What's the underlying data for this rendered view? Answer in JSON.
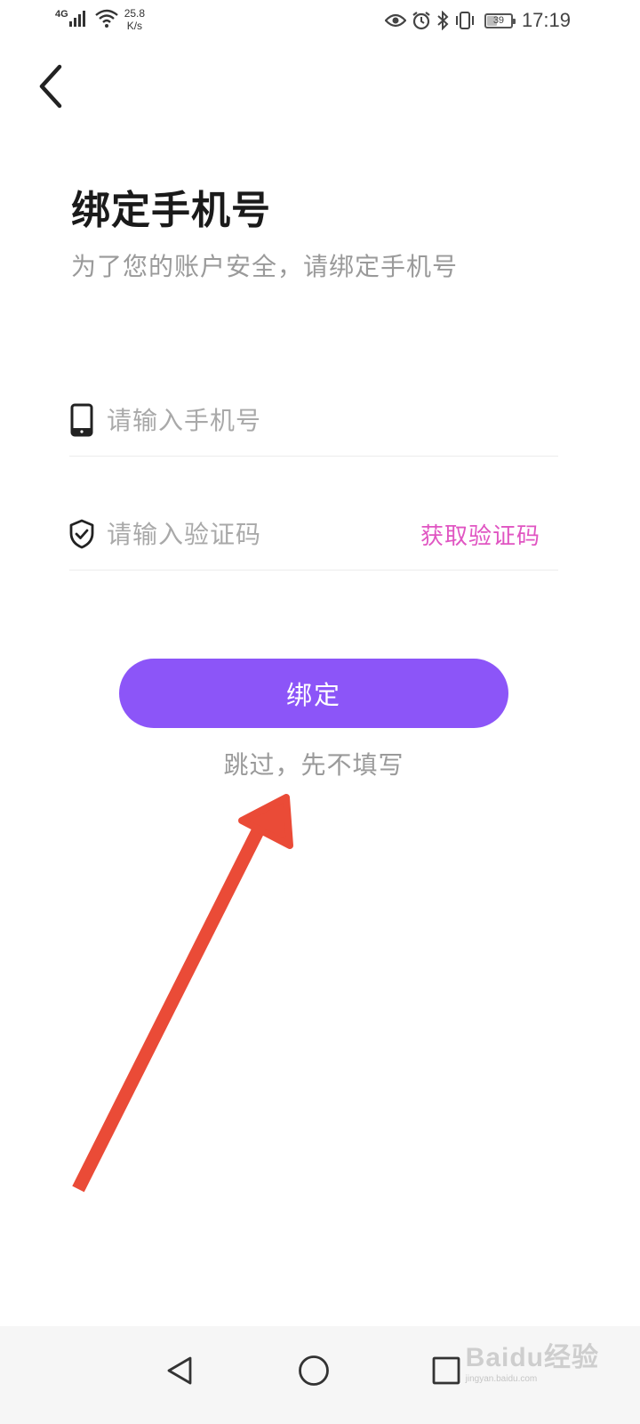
{
  "status_bar": {
    "network_type": "4G",
    "net_speed_value": "25.8",
    "net_speed_unit": "K/s",
    "battery_level": "39",
    "time": "17:19",
    "icons": [
      "signal-icon",
      "wifi-icon",
      "eye-icon",
      "alarm-icon",
      "bluetooth-icon",
      "vibrate-icon",
      "battery-icon"
    ]
  },
  "header": {
    "title": "绑定手机号",
    "subtitle": "为了您的账户安全，请绑定手机号"
  },
  "form": {
    "phone": {
      "placeholder": "请输入手机号",
      "value": "",
      "icon": "phone-icon"
    },
    "code": {
      "placeholder": "请输入验证码",
      "value": "",
      "icon": "shield-check-icon",
      "get_code_label": "获取验证码"
    }
  },
  "actions": {
    "bind_label": "绑定",
    "skip_label": "跳过，先不填写"
  },
  "nav_bar": {
    "buttons": [
      "nav-back-icon",
      "nav-home-icon",
      "nav-recent-icon"
    ]
  },
  "watermark": {
    "logo_text": "Baidu经验",
    "url": "jingyan.baidu.com"
  },
  "colors": {
    "primary_button": "#8c55f8",
    "get_code_text": "#e055c2",
    "annotation_arrow": "#ea4b37",
    "title_text": "#1a1a1a",
    "secondary_text": "#9a9a9a"
  }
}
